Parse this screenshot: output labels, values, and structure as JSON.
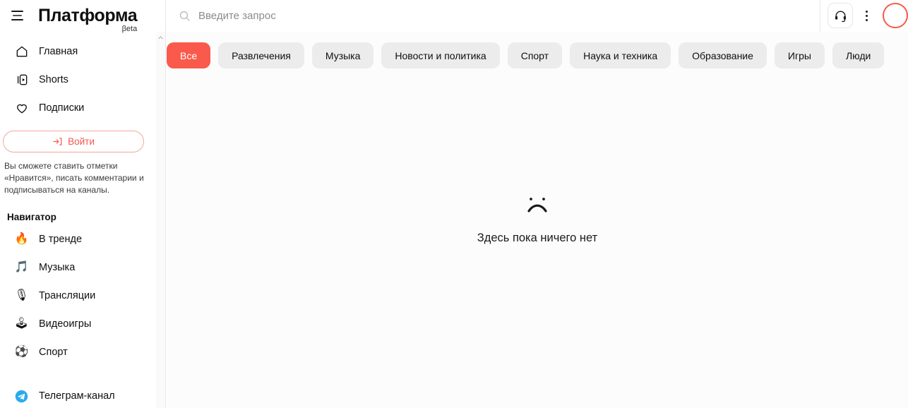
{
  "header": {
    "menu_icon": "hamburger-menu-icon",
    "brand_name": "Платформа",
    "brand_beta": "βeta",
    "search": {
      "icon": "search-icon",
      "placeholder": "Введите запрос",
      "value": ""
    },
    "support_icon": "headset-icon",
    "more_icon": "three-dots-vertical-icon",
    "avatar_icon": "user-avatar-circle",
    "avatar_color": "#f8594b"
  },
  "sidebar": {
    "primary_items": [
      {
        "label": "Главная",
        "icon": "home-icon"
      },
      {
        "label": "Shorts",
        "icon": "shorts-icon"
      },
      {
        "label": "Подписки",
        "icon": "heart-icon"
      }
    ],
    "login": {
      "label": "Войти",
      "icon": "login-arrow-icon",
      "color": "#f2574a",
      "note": "Вы сможете ставить отметки «Нравится», писать комментарии и подписываться на каналы."
    },
    "navigator_title": "Навигатор",
    "navigator_items": [
      {
        "label": "В тренде",
        "icon": "fire-emoji",
        "glyph": "🔥"
      },
      {
        "label": "Музыка",
        "icon": "music-note-emoji",
        "glyph": "🎵"
      },
      {
        "label": "Трансляции",
        "icon": "microphone-emoji",
        "glyph": "🎙"
      },
      {
        "label": "Видеоигры",
        "icon": "joystick-emoji",
        "glyph": "🕹"
      },
      {
        "label": "Спорт",
        "icon": "soccer-ball-emoji",
        "glyph": "⚽"
      }
    ],
    "telegram": {
      "label": "Телеграм-канал",
      "icon": "telegram-icon",
      "color": "#2aabee"
    },
    "scrollbar": {
      "up_arrow_icon": "chevron-up-icon"
    }
  },
  "main": {
    "chips": [
      {
        "label": "Все",
        "active": true
      },
      {
        "label": "Развлечения",
        "active": false
      },
      {
        "label": "Музыка",
        "active": false
      },
      {
        "label": "Новости и политика",
        "active": false
      },
      {
        "label": "Спорт",
        "active": false
      },
      {
        "label": "Наука и техника",
        "active": false
      },
      {
        "label": "Образование",
        "active": false
      },
      {
        "label": "Игры",
        "active": false
      },
      {
        "label": "Люди",
        "active": false
      }
    ],
    "active_chip_color": "#fa5a4b",
    "empty_state": {
      "icon": "sad-face-icon",
      "text": "Здесь пока ничего нет"
    }
  }
}
